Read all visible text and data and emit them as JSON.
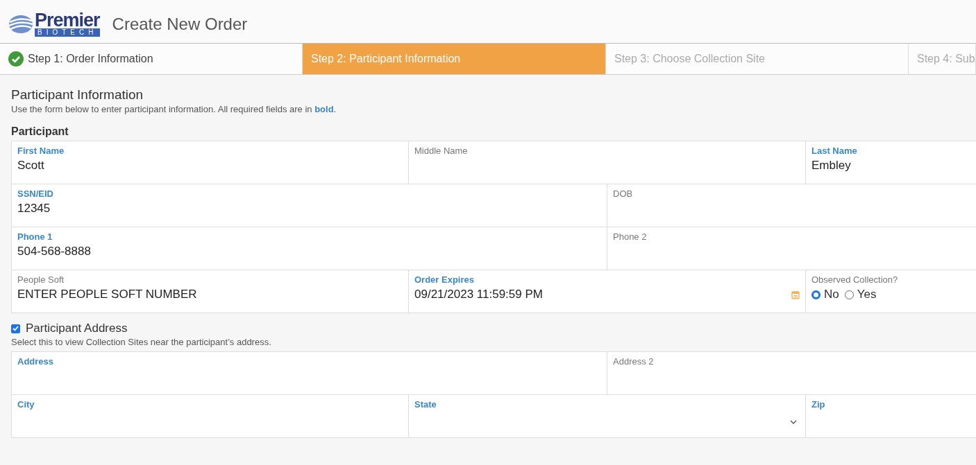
{
  "header": {
    "logo": {
      "name": "Premier",
      "sub": "BIOTECH"
    },
    "title": "Create New Order"
  },
  "steps": [
    {
      "label": "Step 1: Order Information",
      "selected": false,
      "done": true
    },
    {
      "label": "Step 2: Participant Information",
      "selected": true,
      "done": false
    },
    {
      "label": "Step 3: Choose Collection Site",
      "selected": false,
      "done": false
    },
    {
      "label": "Step 4: Sub",
      "selected": false,
      "done": false
    }
  ],
  "section": {
    "title": "Participant Information",
    "intro": "Use the form below to enter participant information. All required fields are in **bold**."
  },
  "participant": {
    "heading": "Participant",
    "rows": [
      [
        {
          "kind": "text",
          "label": "First Name",
          "required": true,
          "value": "Scott"
        },
        {
          "kind": "text",
          "label": "Middle Name",
          "required": false
        },
        {
          "kind": "text",
          "label": "Last Name",
          "required": true,
          "value": "Embley"
        }
      ],
      [
        {
          "kind": "text",
          "label": "SSN/EID",
          "required": true,
          "value": "12345"
        },
        {
          "kind": "text",
          "label": "DOB",
          "required": false
        }
      ],
      [
        {
          "kind": "text",
          "label": "Phone 1",
          "required": true,
          "value": "504-568-8888"
        },
        {
          "kind": "text",
          "label": "Phone 2",
          "required": false
        }
      ],
      [
        {
          "kind": "text",
          "label": "People Soft",
          "required": false,
          "value": "ENTER PEOPLE SOFT NUMBER"
        },
        {
          "kind": "date",
          "label": "Order Expires",
          "required": true,
          "value": "09/21/2023 11:59:59 PM"
        },
        {
          "kind": "radio",
          "label": "Observed Collection?",
          "required": false,
          "options": [
            {
              "label": "No",
              "selected": true
            },
            {
              "label": "Yes",
              "selected": false
            }
          ]
        }
      ]
    ]
  },
  "address": {
    "checkbox": {
      "label": "Participant Address",
      "checked": true
    },
    "hint": "Select this to view Collection Sites near the participant’s address.",
    "rows": [
      [
        {
          "kind": "text",
          "label": "Address",
          "required": true
        },
        {
          "kind": "text",
          "label": "Address 2",
          "required": false
        }
      ],
      [
        {
          "kind": "text",
          "label": "City",
          "required": true
        },
        {
          "kind": "select",
          "label": "State",
          "required": true
        },
        {
          "kind": "text",
          "label": "Zip",
          "required": true
        }
      ]
    ]
  }
}
